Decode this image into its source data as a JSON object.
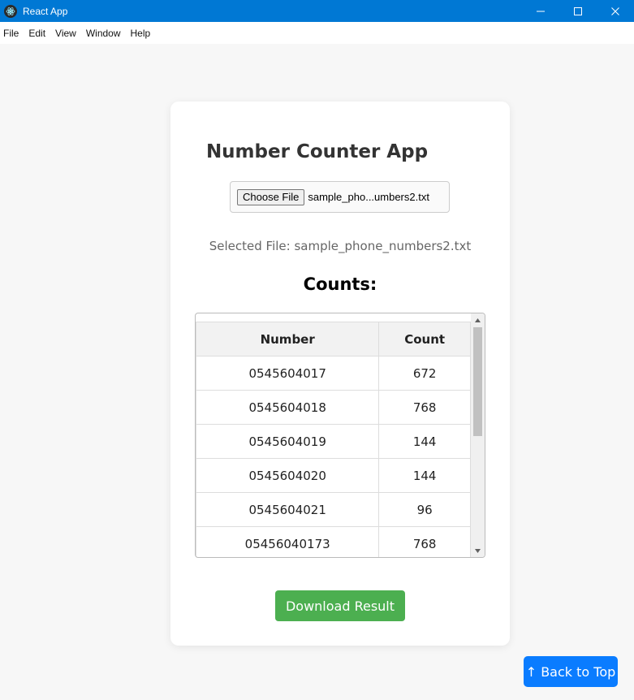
{
  "window": {
    "title": "React App",
    "controls": [
      "minimize-icon",
      "maximize-icon",
      "close-icon"
    ]
  },
  "menu": [
    "File",
    "Edit",
    "View",
    "Window",
    "Help"
  ],
  "app": {
    "title": "Number Counter App",
    "file_input": {
      "button_label": "Choose File",
      "file_name": "sample_pho...umbers2.txt"
    },
    "selected_file": "Selected File: sample_phone_numbers2.txt",
    "counts_heading": "Counts:",
    "table": {
      "headers": [
        "Number",
        "Count"
      ],
      "rows": [
        [
          "0545604017",
          "672"
        ],
        [
          "0545604018",
          "768"
        ],
        [
          "0545604019",
          "144"
        ],
        [
          "0545604020",
          "144"
        ],
        [
          "0545604021",
          "96"
        ],
        [
          "05456040173",
          "768"
        ]
      ]
    },
    "download_button": "Download Result",
    "back_to_top_button": "↑ Back to Top"
  },
  "colors": {
    "titlebar": "#0078d4",
    "download": "#4caf50",
    "back_to_top": "#0a7cff"
  }
}
